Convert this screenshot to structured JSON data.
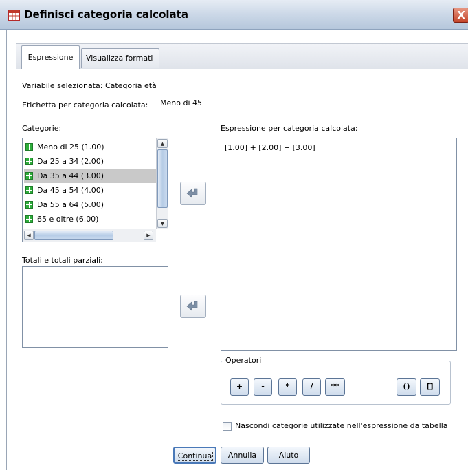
{
  "window": {
    "title": "Definisci categoria calcolata",
    "close_label": "X"
  },
  "tabs": {
    "expression": "Espressione",
    "display_formats": "Visualizza formati"
  },
  "selected_variable": {
    "label": "Variabile selezionata: Categoria età"
  },
  "calc_label": {
    "label": "Etichetta per categoria calcolata:",
    "value": "Meno di 45"
  },
  "categories": {
    "label": "Categorie:",
    "items": [
      {
        "label": "Meno di 25 (1.00)"
      },
      {
        "label": "Da 25 a 34 (2.00)"
      },
      {
        "label": "Da 35 a 44 (3.00)"
      },
      {
        "label": "Da 45 a 54 (4.00)"
      },
      {
        "label": "Da 55 a 64 (5.00)"
      },
      {
        "label": "65 e oltre (6.00)"
      }
    ],
    "selected_index": 2
  },
  "totals": {
    "label": "Totali e totali parziali:"
  },
  "expression": {
    "label": "Espressione per categoria calcolata:",
    "value": "[1.00] + [2.00] + [3.00]"
  },
  "operators": {
    "title": "Operatori",
    "plus": "+",
    "minus": "-",
    "multiply": "*",
    "divide": "/",
    "power": "**",
    "parentheses": "()",
    "brackets": "[]"
  },
  "hide_option": {
    "label": "Nascondi categorie utilizzate nell'espressione da tabella",
    "checked": false
  },
  "buttons": {
    "continue": "Continua",
    "cancel": "Annulla",
    "help": "Aiuto"
  },
  "colors": {
    "title_gradient_top": "#e6ecf4",
    "category_icon": "#2fae3c",
    "selection": "#c9c9c9",
    "close_button": "#c4452a"
  }
}
